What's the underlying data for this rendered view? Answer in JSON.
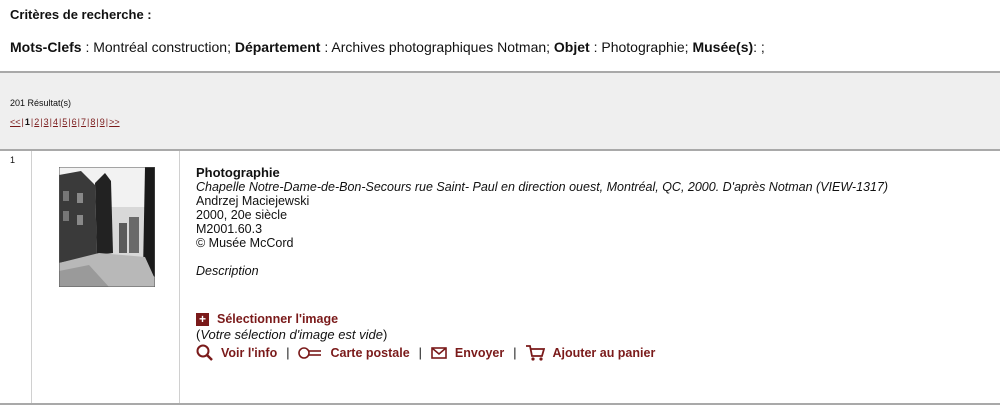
{
  "criteria": {
    "title": "Critères de recherche :",
    "mots_label": "Mots-Clefs",
    "mots_value": " : Montréal construction; ",
    "dept_label": "Département",
    "dept_value": " : Archives photographiques Notman; ",
    "objet_label": "Objet",
    "objet_value": " : Photographie; ",
    "musee_label": "Musée(s)",
    "musee_value": ": ;"
  },
  "results": {
    "count": "201 Résultat(s)",
    "pager": {
      "prev": "<<",
      "pages": [
        "1",
        "2",
        "3",
        "4",
        "5",
        "6",
        "7",
        "8",
        "9"
      ],
      "current": "1",
      "next": ">>",
      "separator": "|"
    }
  },
  "item": {
    "number": "1",
    "type": "Photographie",
    "title": "Chapelle Notre-Dame-de-Bon-Secours rue Saint- Paul en direction ouest, Montréal, QC, 2000. D'après Notman (VIEW-1317)",
    "author": "Andrzej Maciejewski",
    "date": "2000, 20e siècle",
    "accession": "M2001.60.3",
    "copyright": "© Musée McCord",
    "description_label": "Description",
    "select_label": "Sélectionner l'image",
    "selection_note_open": "(",
    "selection_note": "Votre sélection d'image est vide",
    "selection_note_close": ")",
    "actions": {
      "info": "Voir l'info",
      "postcard": "Carte postale",
      "send": "Envoyer",
      "cart": "Ajouter au panier",
      "separator": "|"
    }
  },
  "colors": {
    "accent": "#7a1a1a",
    "bar_bg": "#efefef",
    "rule": "#a9a9a9"
  }
}
